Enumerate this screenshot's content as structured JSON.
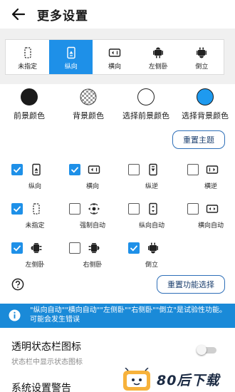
{
  "header": {
    "title": "更多设置"
  },
  "orientation_tabs": [
    {
      "label": "未指定",
      "icon": "dotted-phone-icon",
      "active": false
    },
    {
      "label": "纵向",
      "icon": "portrait-phone-icon",
      "active": true
    },
    {
      "label": "横向",
      "icon": "landscape-phone-icon",
      "active": false
    },
    {
      "label": "左侧卧",
      "icon": "android-robot-left-icon",
      "active": false
    },
    {
      "label": "倒立",
      "icon": "android-robot-upside-icon",
      "active": false
    }
  ],
  "colors": {
    "labels": [
      "前景颜色",
      "背景颜色",
      "选择前景颜色",
      "选择背景颜色"
    ],
    "swatches": [
      "#1a1a1a",
      "checkerboard",
      "#ffffff",
      "#1e9aef"
    ]
  },
  "reset_theme_label": "重置主题",
  "modes": [
    {
      "label": "纵向",
      "checked": true,
      "icon": "portrait-phone-icon"
    },
    {
      "label": "横向",
      "checked": true,
      "icon": "landscape-phone-icon"
    },
    {
      "label": "纵逆",
      "checked": false,
      "icon": "reverse-portrait-icon"
    },
    {
      "label": "横逆",
      "checked": false,
      "icon": "reverse-landscape-icon"
    },
    {
      "label": "未指定",
      "checked": true,
      "icon": "dotted-phone-icon"
    },
    {
      "label": "强制自动",
      "checked": false,
      "icon": "auto-rotate-icon"
    },
    {
      "label": "纵向自动",
      "checked": false,
      "icon": "portrait-auto-icon"
    },
    {
      "label": "横向自动",
      "checked": false,
      "icon": "landscape-auto-icon"
    },
    {
      "label": "左侧卧",
      "checked": true,
      "icon": "android-robot-left-icon"
    },
    {
      "label": "右侧卧",
      "checked": false,
      "icon": "android-robot-right-icon"
    },
    {
      "label": "倒立",
      "checked": true,
      "icon": "android-robot-upside-icon"
    }
  ],
  "reset_functions_label": "重置功能选择",
  "info_banner": "\"纵向自动\"\"横向自动\"\"左侧卧\"\"右侧卧\"\"倒立\"是试验性功能。可能会发生错误",
  "transparent_status_bar": {
    "title": "透明状态栏图标",
    "subtitle": "状态栏中显示状态图标",
    "enabled": false
  },
  "system_warning": {
    "title": "系统设置警告"
  },
  "watermark": {
    "text": "80后下载"
  },
  "accent_color": "#1e90e8"
}
